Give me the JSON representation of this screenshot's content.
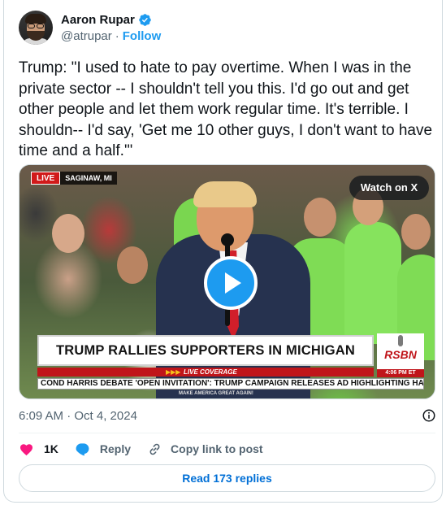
{
  "author": {
    "display_name": "Aaron Rupar",
    "handle": "@atrupar",
    "separator": "·",
    "follow_label": "Follow"
  },
  "tweet": {
    "text": "Trump: \"I used to hate to pay overtime. When I was in the private sector -- I shouldn't tell you this. I'd go out and get other people and let them work regular time. It's terrible. I shouldn-- I'd say, 'Get me 10 other guys, I don't want to have time and a half.'\""
  },
  "media": {
    "live_badge": "LIVE",
    "location": "SAGINAW, MI",
    "watch_label": "Watch on X",
    "chyron": "TRUMP RALLIES SUPPORTERS IN MICHIGAN",
    "live_coverage": "LIVE COVERAGE",
    "live_arrows": "▶▶▶",
    "network": "RSBN",
    "network_time": "4:06 PM ET",
    "ticker": "COND HARRIS DEBATE    'OPEN INVITATION': TRUMP CAMPAIGN RELEASES AD HIGHLIGHTING HAR",
    "bottom_text": "MAKE AMERICA GREAT AGAIN!"
  },
  "meta": {
    "timestamp": "6:09 AM · Oct 4, 2024"
  },
  "actions": {
    "like_count": "1K",
    "reply_label": "Reply",
    "copy_label": "Copy link to post"
  },
  "replies": {
    "label": "Read 173 replies"
  },
  "colors": {
    "accent": "#1d9bf0",
    "like": "#f91880",
    "link": "#006fd6",
    "muted": "#536471"
  },
  "icons": [
    "verified-badge-icon",
    "play-icon",
    "heart-icon",
    "reply-bubble-icon",
    "link-icon",
    "info-icon",
    "mic-icon"
  ]
}
